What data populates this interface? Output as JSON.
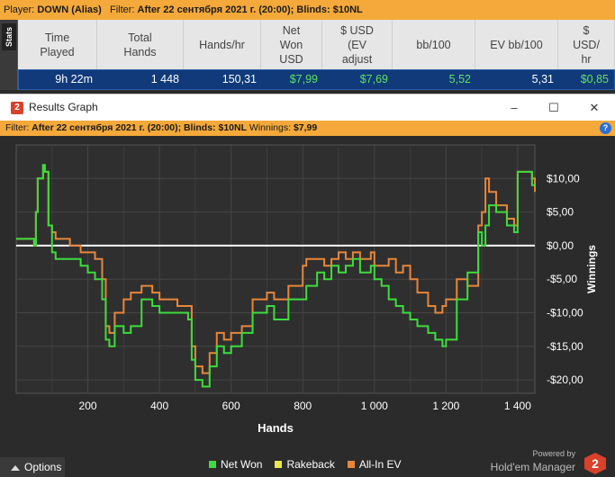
{
  "topbar": {
    "player_label": "Player:",
    "player_value": "DOWN (Alias)",
    "filter_label": "Filter:",
    "filter_value": "After 22 сентября 2021 г. (20:00); Blinds: $10NL"
  },
  "stats_tab": "Stats",
  "stats": {
    "headers": [
      "Time\nPlayed",
      "Total\nHands",
      "Hands/hr",
      "Net\nWon\nUSD",
      "$ USD\n(EV\nadjust",
      "bb/100",
      "EV bb/100",
      "$\nUSD/\nhr"
    ],
    "row": [
      "9h 22m",
      "1 448",
      "150,31",
      "$7,99",
      "$7,69",
      "5,52",
      "5,31",
      "$0,85"
    ]
  },
  "window": {
    "title": "Results Graph",
    "logo": "2",
    "min": "–",
    "max": "☐",
    "close": "✕"
  },
  "filterbar": {
    "label": "Filter:",
    "value": "After 22 сентября 2021 г. (20:00); Blinds: $10NL",
    "winnings_label": "Winnings:",
    "winnings_value": "$7,99",
    "help": "?"
  },
  "legend": {
    "net_won": "Net Won",
    "rakeback": "Rakeback",
    "allin_ev": "All-In EV"
  },
  "colors": {
    "net_won": "#3ddc3d",
    "rakeback": "#e8e84a",
    "allin_ev": "#e8863a",
    "accent": "#f4a93a"
  },
  "options_label": "Options",
  "brand": {
    "powered": "Powered by",
    "name": "Hold'em Manager",
    "logo": "2"
  },
  "chart_data": {
    "type": "line",
    "xlabel": "Hands",
    "ylabel": "Winnings",
    "xlim": [
      0,
      1448
    ],
    "ylim": [
      -22,
      15
    ],
    "xticks": [
      200,
      400,
      600,
      800,
      1000,
      1200,
      1400
    ],
    "xtick_labels": [
      "200",
      "400",
      "600",
      "800",
      "1 000",
      "1 200",
      "1 400"
    ],
    "yticks": [
      10,
      5,
      0,
      -5,
      -10,
      -15,
      -20
    ],
    "ytick_labels": [
      "$10,00",
      "$5,00",
      "$0,00",
      "-$5,00",
      "-$10,00",
      "-$15,00",
      "-$20,00"
    ],
    "grid": true,
    "legend_position": "bottom",
    "series": [
      {
        "name": "Net Won",
        "x": [
          0,
          30,
          50,
          55,
          60,
          75,
          80,
          90,
          100,
          110,
          150,
          180,
          200,
          220,
          240,
          250,
          260,
          275,
          300,
          320,
          350,
          380,
          400,
          450,
          480,
          490,
          500,
          520,
          540,
          560,
          580,
          600,
          630,
          660,
          700,
          720,
          760,
          800,
          810,
          840,
          860,
          880,
          900,
          920,
          940,
          960,
          990,
          1000,
          1020,
          1040,
          1060,
          1080,
          1100,
          1120,
          1150,
          1170,
          1190,
          1200,
          1230,
          1260,
          1290,
          1300,
          1310,
          1320,
          1340,
          1370,
          1390,
          1400,
          1420,
          1440,
          1448
        ],
        "y": [
          1,
          1,
          0,
          5,
          10,
          12,
          11,
          3,
          -1,
          -2,
          -2,
          -3,
          -4,
          -5,
          -8,
          -14,
          -15,
          -12,
          -13,
          -12,
          -8,
          -9,
          -10,
          -10,
          -11,
          -17,
          -20,
          -21,
          -18,
          -15,
          -16,
          -15,
          -13,
          -10,
          -9,
          -11,
          -8,
          -8,
          -6,
          -4,
          -5,
          -3,
          -4,
          -3,
          -2,
          -4,
          -3,
          -5,
          -6,
          -8,
          -9,
          -10,
          -11,
          -12,
          -13,
          -14,
          -15,
          -14,
          -8,
          -4,
          2,
          0,
          3,
          6,
          5,
          3,
          2,
          11,
          11,
          9,
          9
        ]
      },
      {
        "name": "All-In EV",
        "x": [
          0,
          30,
          50,
          55,
          60,
          75,
          80,
          90,
          100,
          110,
          150,
          180,
          200,
          220,
          240,
          250,
          260,
          275,
          300,
          320,
          350,
          380,
          400,
          450,
          480,
          490,
          500,
          520,
          540,
          560,
          580,
          600,
          630,
          660,
          700,
          720,
          760,
          800,
          810,
          840,
          860,
          880,
          900,
          920,
          940,
          960,
          990,
          1000,
          1020,
          1040,
          1060,
          1080,
          1100,
          1120,
          1150,
          1170,
          1190,
          1200,
          1230,
          1260,
          1290,
          1300,
          1310,
          1320,
          1340,
          1370,
          1390,
          1400,
          1420,
          1440,
          1448
        ],
        "y": [
          1,
          1,
          0,
          5,
          10,
          12,
          11,
          3,
          2,
          1,
          0,
          -1,
          -1,
          -2,
          -5,
          -12,
          -13,
          -10,
          -8,
          -7,
          -6,
          -7,
          -8,
          -9,
          -9,
          -15,
          -18,
          -19,
          -16,
          -13,
          -14,
          -13,
          -12,
          -8,
          -7,
          -8,
          -6,
          -3,
          -2,
          -2,
          -3,
          -2,
          -1,
          -2,
          -1,
          -2,
          -1,
          -3,
          -3,
          -2,
          -4,
          -3,
          -5,
          -7,
          -9,
          -10,
          -9,
          -8,
          -5,
          -6,
          3,
          5,
          10,
          8,
          6,
          4,
          3,
          11,
          11,
          10,
          8
        ]
      },
      {
        "name": "Rakeback",
        "x": [
          0,
          1448
        ],
        "y": [
          0,
          0
        ]
      }
    ]
  }
}
